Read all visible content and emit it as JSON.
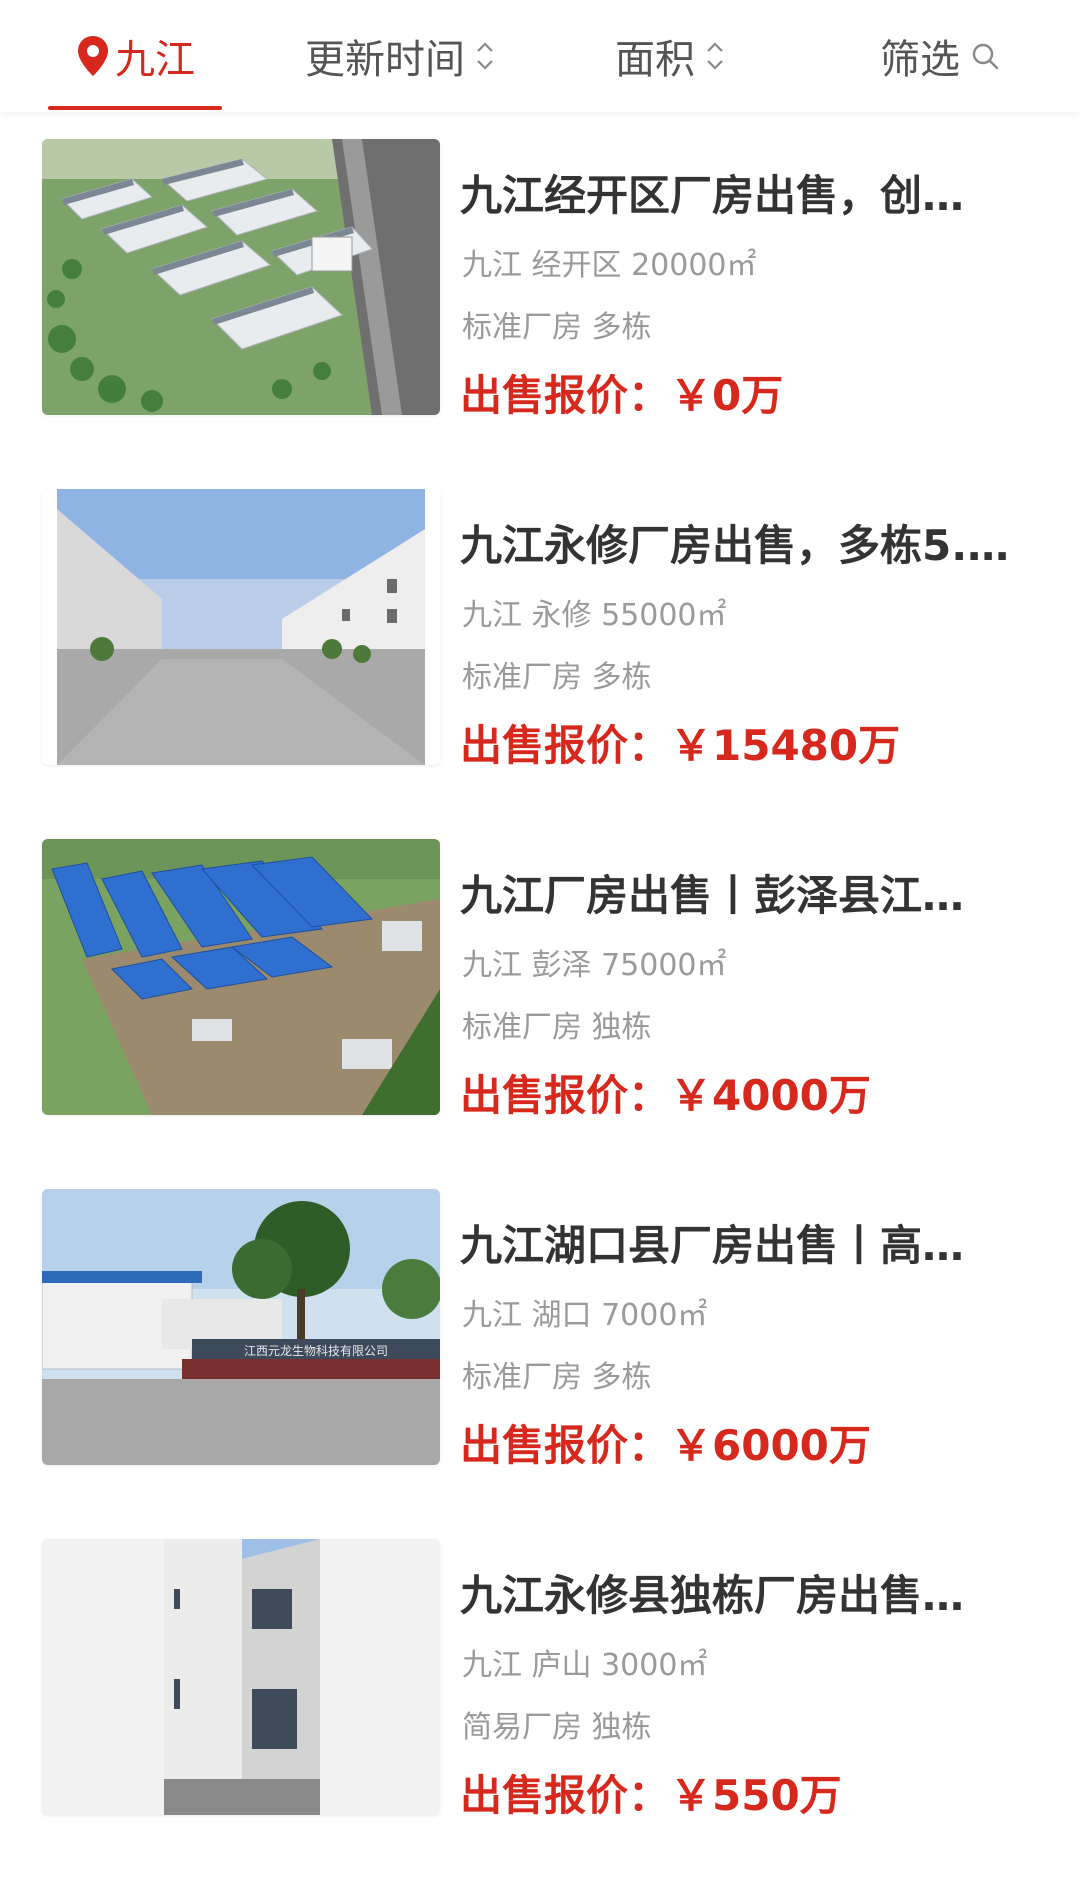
{
  "filter_bar": {
    "city": "九江",
    "update_time": "更新时间",
    "area": "面积",
    "filter": "筛选"
  },
  "colors": {
    "accent": "#d7281e",
    "title": "#333333",
    "meta": "#9a9a9a"
  },
  "listings": [
    {
      "title": "九江经开区厂房出售，创…",
      "location": "九江 经开区 20000㎡",
      "tags": "标准厂房 多栋",
      "price_label": "出售报价：",
      "price_value": "￥0万",
      "image": "aerial-factory-park"
    },
    {
      "title": "九江永修厂房出售，多栋5.…",
      "location": "九江 永修 55000㎡",
      "tags": "标准厂房 多栋",
      "price_label": "出售报价：",
      "price_value": "￥15480万",
      "image": "factory-street-view"
    },
    {
      "title": "九江厂房出售丨彭泽县江…",
      "location": "九江 彭泽 75000㎡",
      "tags": "标准厂房 独栋",
      "price_label": "出售报价：",
      "price_value": "￥4000万",
      "image": "blue-roof-aerial"
    },
    {
      "title": "九江湖口县厂房出售丨高…",
      "location": "九江 湖口 7000㎡",
      "tags": "标准厂房 多栋",
      "price_label": "出售报价：",
      "price_value": "￥6000万",
      "image": "company-gate-with-tree",
      "image_sign": "江西元龙生物科技有限公司"
    },
    {
      "title": "九江永修县独栋厂房出售…",
      "location": "九江 庐山 3000㎡",
      "tags": "简易厂房 独栋",
      "price_label": "出售报价：",
      "price_value": "￥550万",
      "image": "building-wall-vertical"
    }
  ]
}
